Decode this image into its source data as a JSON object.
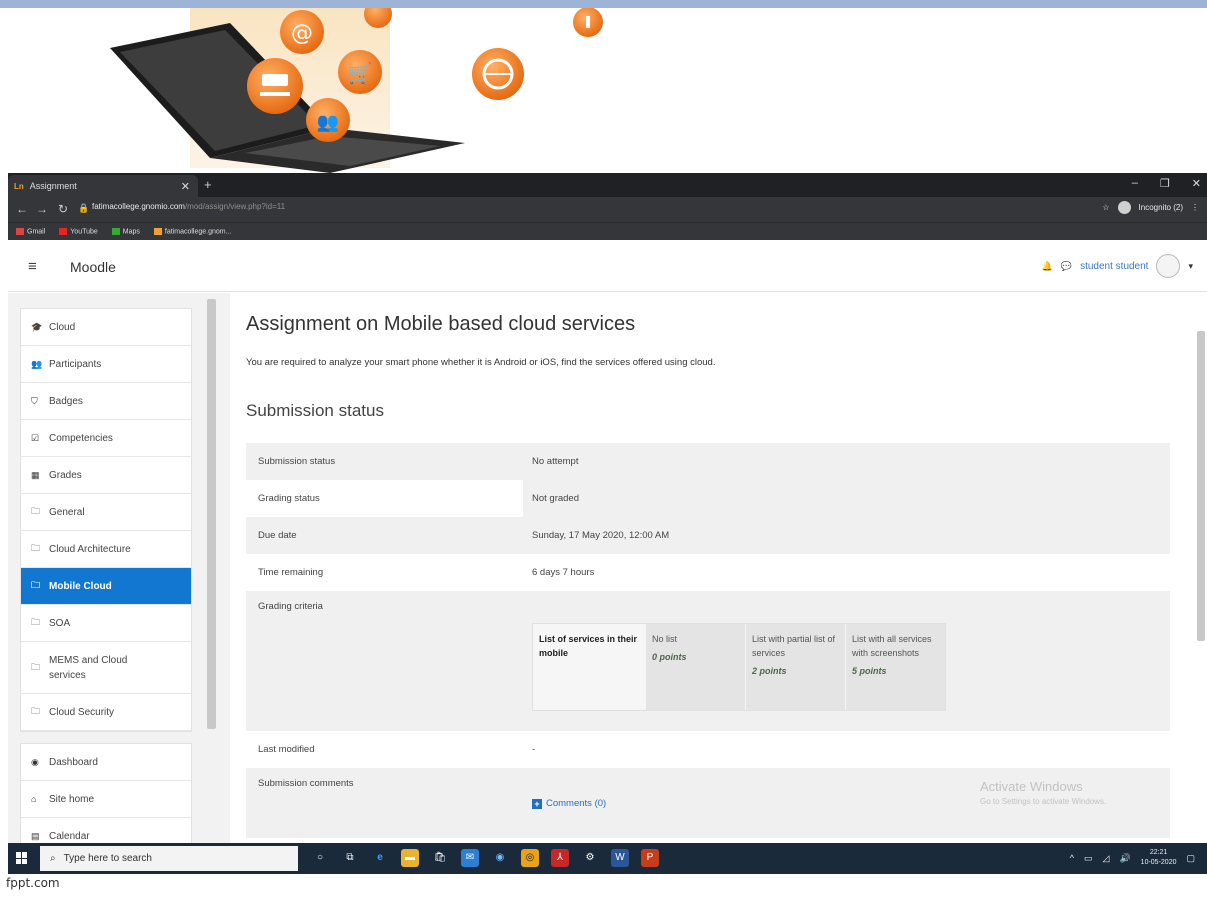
{
  "footer": "fppt.com",
  "browser": {
    "tab_title": "Assignment",
    "tab_favicon": "Ln",
    "url_host": "fatimacollege.gnomio.com",
    "url_path": "/mod/assign/view.php?id=11",
    "incognito": "Incognito (2)",
    "bookmarks": [
      "Gmail",
      "YouTube",
      "Maps",
      "fatimacollege.gnom..."
    ]
  },
  "moodle": {
    "brand": "Moodle",
    "user": "student student"
  },
  "drawer": {
    "course_items": [
      {
        "icon": "graduation-cap-icon",
        "glyph": "🎓",
        "label": "Cloud"
      },
      {
        "icon": "users-icon",
        "glyph": "👥",
        "label": "Participants"
      },
      {
        "icon": "shield-icon",
        "glyph": "⛉",
        "label": "Badges"
      },
      {
        "icon": "checkbox-icon",
        "glyph": "☑",
        "label": "Competencies"
      },
      {
        "icon": "table-icon",
        "glyph": "▦",
        "label": "Grades"
      },
      {
        "icon": "folder-icon",
        "glyph": "🗀",
        "label": "General"
      },
      {
        "icon": "folder-icon",
        "glyph": "🗀",
        "label": "Cloud Architecture"
      },
      {
        "icon": "folder-icon",
        "glyph": "🗀",
        "label": "Mobile Cloud",
        "active": true
      },
      {
        "icon": "folder-icon",
        "glyph": "🗀",
        "label": "SOA"
      },
      {
        "icon": "folder-icon",
        "glyph": "🗀",
        "label": "MEMS and Cloud services"
      },
      {
        "icon": "folder-icon",
        "glyph": "🗀",
        "label": "Cloud Security"
      }
    ],
    "site_items": [
      {
        "icon": "dashboard-icon",
        "glyph": "◉",
        "label": "Dashboard"
      },
      {
        "icon": "home-icon",
        "glyph": "⌂",
        "label": "Site home"
      },
      {
        "icon": "calendar-icon",
        "glyph": "▤",
        "label": "Calendar"
      }
    ]
  },
  "page": {
    "title": "Assignment on Mobile based cloud services",
    "intro": "You are required to analyze your smart phone whether it is Android or iOS, find the services offered using cloud.",
    "subheading": "Submission status",
    "status": {
      "submission_status_label": "Submission status",
      "submission_status_value": "No attempt",
      "grading_status_label": "Grading status",
      "grading_status_value": "Not graded",
      "due_date_label": "Due date",
      "due_date_value": "Sunday, 17 May 2020, 12:00 AM",
      "time_remaining_label": "Time remaining",
      "time_remaining_value": "6 days 7 hours",
      "grading_criteria_label": "Grading criteria",
      "last_modified_label": "Last modified",
      "last_modified_value": "-",
      "submission_comments_label": "Submission comments",
      "comments_link": "Comments (0)"
    },
    "rubric": {
      "criterion": "List of services in their mobile",
      "levels": [
        {
          "desc": "No list",
          "points": "0 points"
        },
        {
          "desc": "List with partial list of services",
          "points": "2 points"
        },
        {
          "desc": "List with all services with screenshots",
          "points": "5 points"
        }
      ]
    },
    "watermark": {
      "line1": "Activate Windows",
      "line2": "Go to Settings to activate Windows."
    }
  },
  "taskbar": {
    "search_placeholder": "Type here to search",
    "time": "22:21",
    "date": "10-05-2020"
  }
}
